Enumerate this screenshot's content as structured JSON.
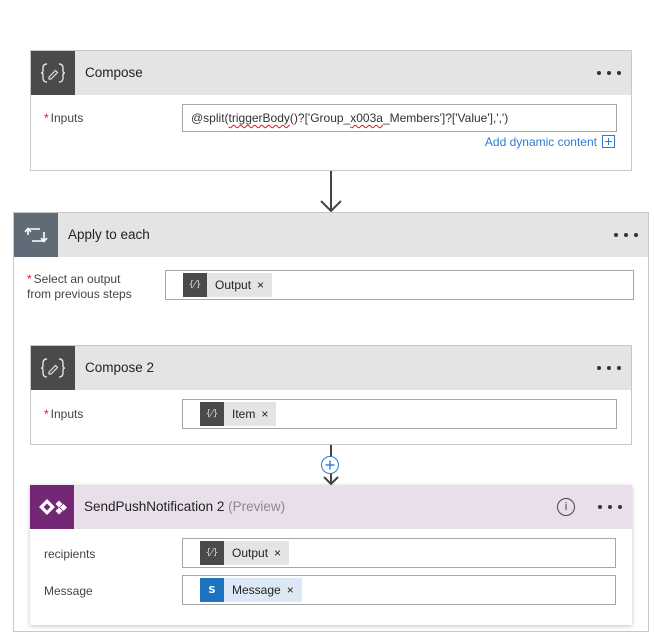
{
  "compose": {
    "title": "Compose",
    "icon": "braces-pencil-icon",
    "inputs_label": "Inputs",
    "inputs_required": true,
    "inputs_value_prefix": "@split(",
    "inputs_value_flagged1": "triggerBody",
    "inputs_value_mid": "()?['Group_",
    "inputs_value_flagged2": "x003a",
    "inputs_value_suffix": "_Members']?['Value'],',')",
    "add_dynamic_label": "Add dynamic content",
    "menu": "more-options"
  },
  "apply_to_each": {
    "title": "Apply to each",
    "icon": "loop-icon",
    "select_label_line1": "Select an output",
    "select_label_line2": "from previous steps",
    "select_required": true,
    "select_token": {
      "label": "Output",
      "icon": "compose-token-icon",
      "remove": "×"
    }
  },
  "compose2": {
    "title": "Compose 2",
    "icon": "braces-pencil-icon",
    "inputs_label": "Inputs",
    "inputs_required": true,
    "inputs_token": {
      "label": "Item",
      "icon": "compose-token-icon",
      "remove": "×"
    }
  },
  "push": {
    "title": "SendPushNotification 2",
    "title_suffix": "(Preview)",
    "icon": "powerapps-icon",
    "brand_color": "#742774",
    "header_color": "#e9dfeb",
    "recipients_label": "recipients",
    "recipients_token": {
      "label": "Output",
      "icon": "compose-token-icon",
      "remove": "×"
    },
    "message_label": "Message",
    "message_token": {
      "label": "Message",
      "icon": "sharepoint-icon",
      "remove": "×"
    }
  },
  "glyphs": {
    "required": "*",
    "compose_token": "{⁄}",
    "sharepoint_token": "S"
  }
}
